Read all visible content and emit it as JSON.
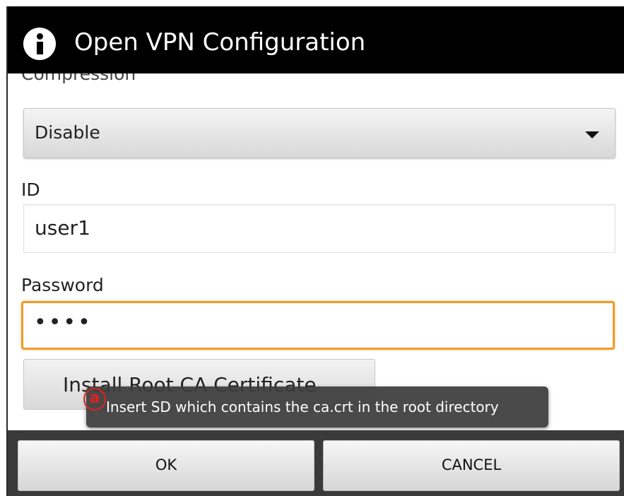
{
  "dialog": {
    "title": "Open VPN Configuration",
    "title_icon": "info-icon"
  },
  "form": {
    "compression": {
      "label": "Compression",
      "value": "Disable"
    },
    "id": {
      "label": "ID",
      "value": "user1"
    },
    "password": {
      "label": "Password",
      "masked_value": "••••"
    },
    "install_button_label": "Install Root CA Certificate"
  },
  "toast": {
    "marker": "a",
    "message": "Insert SD which contains the ca.crt in the root directory"
  },
  "buttons": {
    "ok": "OK",
    "cancel": "CANCEL"
  },
  "colors": {
    "focus_accent": "#f19a26",
    "annotation_marker": "#dd2222"
  }
}
